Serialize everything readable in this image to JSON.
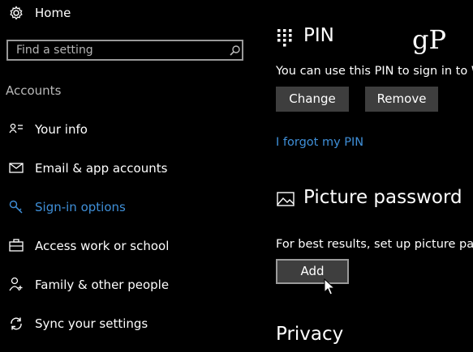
{
  "colors": {
    "accent": "#3f8fd8",
    "background": "#000000",
    "button_bg": "#3e3e3e",
    "search_border": "#999999"
  },
  "sidebar": {
    "home_label": "Home",
    "search_placeholder": "Find a setting",
    "section_label": "Accounts",
    "items": [
      {
        "label": "Your info",
        "icon": "person-card-icon",
        "selected": false
      },
      {
        "label": "Email & app accounts",
        "icon": "mail-icon",
        "selected": false
      },
      {
        "label": "Sign-in options",
        "icon": "key-icon",
        "selected": true
      },
      {
        "label": "Access work or school",
        "icon": "briefcase-icon",
        "selected": false
      },
      {
        "label": "Family & other people",
        "icon": "people-icon",
        "selected": false
      },
      {
        "label": "Sync your settings",
        "icon": "sync-icon",
        "selected": false
      }
    ]
  },
  "main": {
    "pin": {
      "title": "PIN",
      "description": "You can use this PIN to sign in to Win",
      "change_label": "Change",
      "remove_label": "Remove",
      "forgot_link": "I forgot my PIN"
    },
    "picture_password": {
      "title": "Picture password",
      "description": "For best results, set up picture passw",
      "add_label": "Add"
    },
    "privacy": {
      "title": "Privacy"
    }
  },
  "watermark": "gP"
}
